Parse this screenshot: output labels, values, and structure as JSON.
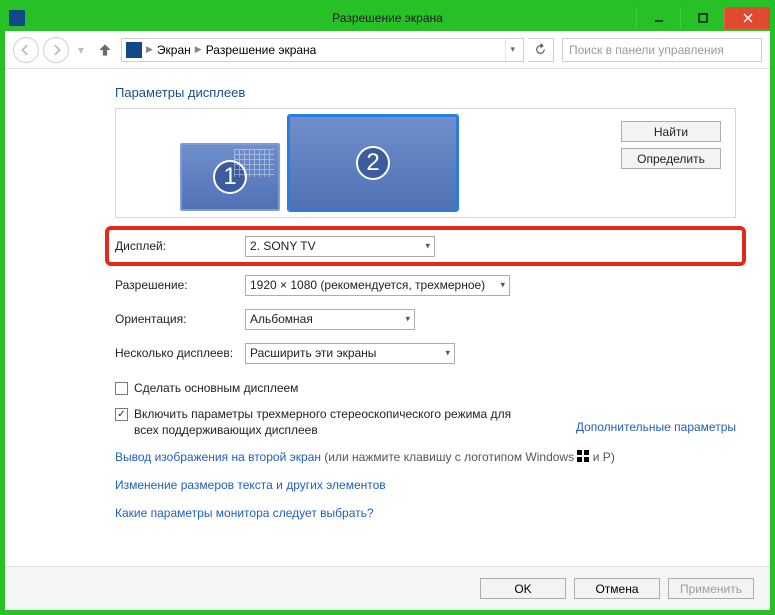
{
  "window": {
    "title": "Разрешение экрана"
  },
  "breadcrumb": {
    "item1": "Экран",
    "item2": "Разрешение экрана"
  },
  "search": {
    "placeholder": "Поиск в панели управления"
  },
  "heading": "Параметры дисплеев",
  "preview": {
    "d1_number": "1",
    "d2_number": "2",
    "find_btn": "Найти",
    "identify_btn": "Определить"
  },
  "form": {
    "display_label": "Дисплей:",
    "display_value": "2. SONY TV",
    "resolution_label": "Разрешение:",
    "resolution_value": "1920 × 1080 (рекомендуется, трехмерное)",
    "orientation_label": "Ориентация:",
    "orientation_value": "Альбомная",
    "multidisp_label": "Несколько дисплеев:",
    "multidisp_value": "Расширить эти экраны"
  },
  "checkboxes": {
    "make_main": "Сделать основным дисплеем",
    "enable_3d": "Включить параметры трехмерного стереоскопического режима для всех поддерживающих дисплеев"
  },
  "links": {
    "advanced": "Дополнительные параметры",
    "second_screen_prefix": "Вывод изображения на второй экран",
    "second_screen_suffix": " (или нажмите клавишу с логотипом Windows ",
    "second_screen_tail": " и P)",
    "resize_text": "Изменение размеров текста и других элементов",
    "which_params": "Какие параметры монитора следует выбрать?"
  },
  "footer": {
    "ok": "OK",
    "cancel": "Отмена",
    "apply": "Применить"
  }
}
